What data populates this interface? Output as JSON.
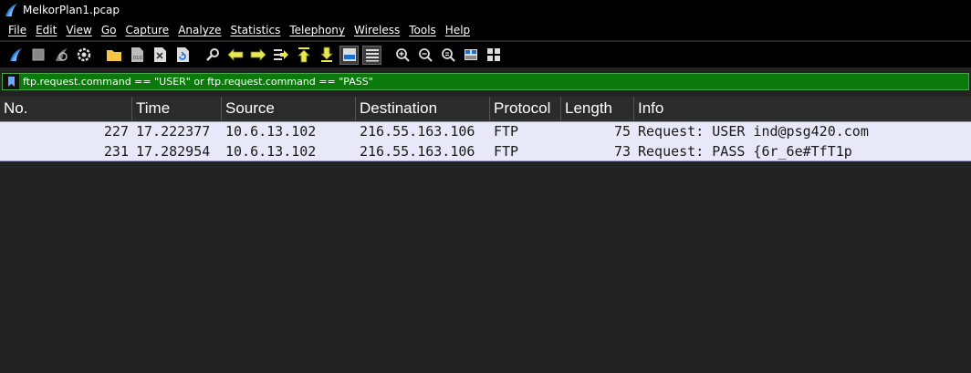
{
  "window": {
    "title": "MelkorPlan1.pcap",
    "icon": "wireshark-fin-icon"
  },
  "menu": [
    "File",
    "Edit",
    "View",
    "Go",
    "Capture",
    "Analyze",
    "Statistics",
    "Telephony",
    "Wireless",
    "Tools",
    "Help"
  ],
  "toolbar": {
    "icons": [
      "start-capture-icon",
      "stop-capture-icon",
      "restart-capture-icon",
      "capture-options-icon",
      "open-file-icon",
      "save-file-icon",
      "close-file-icon",
      "reload-file-icon",
      "find-packet-icon",
      "go-back-icon",
      "go-forward-icon",
      "go-to-packet-icon",
      "go-first-icon",
      "go-last-icon",
      "auto-scroll-icon",
      "colorize-icon",
      "zoom-in-icon",
      "zoom-out-icon",
      "zoom-normal-icon",
      "resize-columns-icon",
      "layout-icon"
    ]
  },
  "filter": {
    "text": "ftp.request.command == \"USER\" or ftp.request.command == \"PASS\""
  },
  "columns": [
    "No.",
    "Time",
    "Source",
    "Destination",
    "Protocol",
    "Length",
    "Info"
  ],
  "packets": [
    {
      "no": "227",
      "time": "17.222377",
      "source": "10.6.13.102",
      "destination": "216.55.163.106",
      "protocol": "FTP",
      "length": "75",
      "info": "Request: USER ind@psg420.com"
    },
    {
      "no": "231",
      "time": "17.282954",
      "source": "10.6.13.102",
      "destination": "216.55.163.106",
      "protocol": "FTP",
      "length": "73",
      "info": "Request: PASS {6r_6e#TfT1p"
    }
  ],
  "colors": {
    "row_bg": "#e8e8f8",
    "filter_bg": "#0a7a0a",
    "background": "#232323"
  }
}
